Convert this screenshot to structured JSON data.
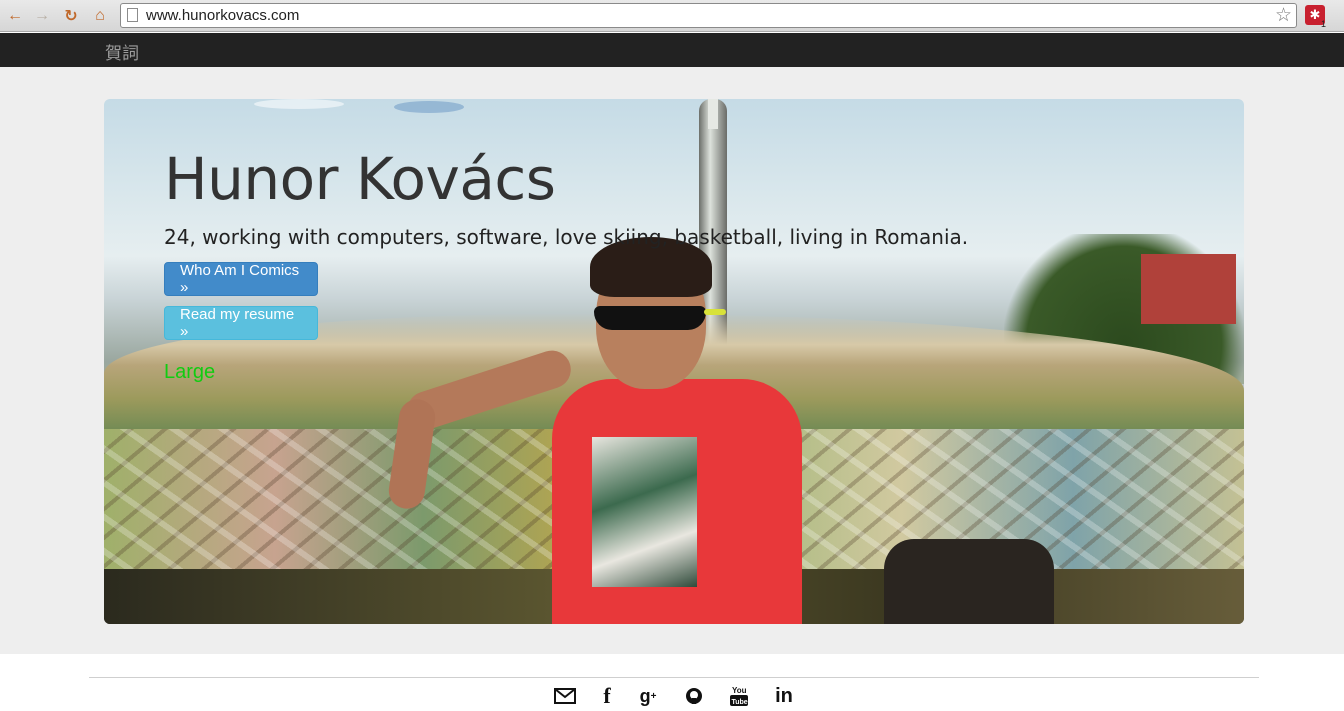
{
  "browser": {
    "url": "www.hunorkovacs.com",
    "extension_badge": "1"
  },
  "navbar": {
    "brand": "賀詞"
  },
  "hero": {
    "title": "Hunor Kovács",
    "subtitle": "24, working with computers, software, love skiing, basketball, living in Romania.",
    "primary_button": "Who Am I Comics »",
    "info_button": "Read my resume »",
    "size_label": "Large"
  },
  "footer": {
    "social_icons": [
      "mail-icon",
      "facebook-icon",
      "google-plus-icon",
      "github-icon",
      "youtube-icon",
      "linkedin-icon"
    ]
  },
  "colors": {
    "navbar_bg": "#222222",
    "page_bg": "#eeeeee",
    "primary": "#428bca",
    "info": "#5bc0de",
    "large_label": "#11cc11"
  }
}
